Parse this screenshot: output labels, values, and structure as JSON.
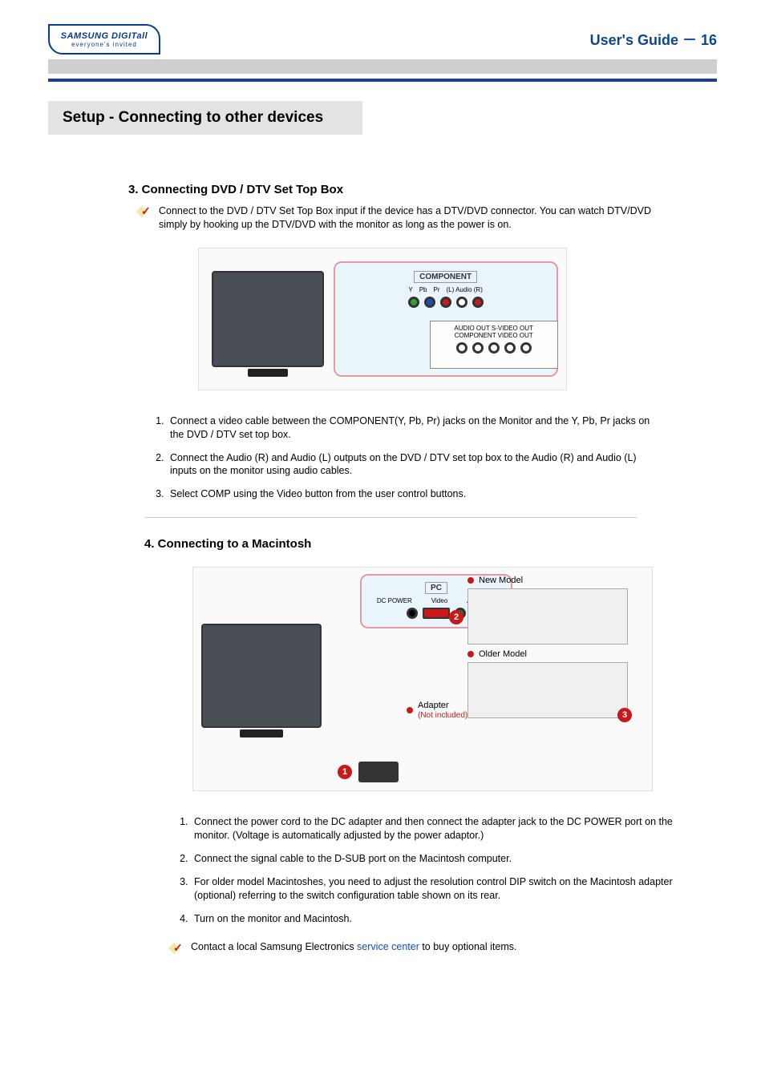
{
  "header": {
    "logo_top": "SAMSUNG DIGITall",
    "logo_bottom": "everyone's invited",
    "right": "User's Guide － 16"
  },
  "section_title": "Setup - Connecting to other devices",
  "section3": {
    "title": "3. Connecting DVD / DTV Set Top Box",
    "note": "Connect to the  DVD / DTV Set Top Box input if the device has a DTV/DVD connector. You can watch DTV/DVD simply by hooking up the DTV/DVD with the monitor as long as the power is on.",
    "diagram": {
      "panel_label": "COMPONENT",
      "jack_labels": [
        "Y",
        "Pb",
        "Pr",
        "(L) Audio (R)"
      ],
      "device_labels": "AUDIO OUT   S-VIDEO OUT   COMPONENT VIDEO OUT"
    },
    "steps": [
      "Connect a video cable between the COMPONENT(Y, Pb, Pr) jacks on the Monitor and the Y, Pb, Pr jacks on the DVD / DTV set top box.",
      "Connect the Audio (R) and Audio (L) outputs on the  DVD / DTV set top box to the Audio (R) and Audio (L) inputs on the monitor using audio cables.",
      "Select COMP using the Video button from the user control buttons."
    ]
  },
  "section4": {
    "title": "4. Connecting to a Macintosh",
    "diagram": {
      "pc_label": "PC",
      "dc_power": "DC POWER",
      "video": "Video",
      "audio": "Audio(ST)",
      "new_model": "New Model",
      "older_model": "Older Model",
      "adapter": "Adapter",
      "not_included": "(Not included)",
      "callouts": [
        "1",
        "2",
        "3"
      ]
    },
    "steps": [
      "Connect the power cord to the DC adapter and then connect the adapter jack to the DC POWER port on the monitor. (Voltage is automatically adjusted by the power adaptor.)",
      "Connect the signal cable to the D-SUB port on the Macintosh computer.",
      "For older model Macintoshes, you need to adjust the resolution control DIP switch on the Macintosh adapter (optional) referring to the switch configuration table shown on its rear.",
      "Turn on the monitor and Macintosh."
    ],
    "footer_pre": "Contact a local Samsung Electronics ",
    "footer_link": "service center",
    "footer_post": " to buy optional items."
  }
}
